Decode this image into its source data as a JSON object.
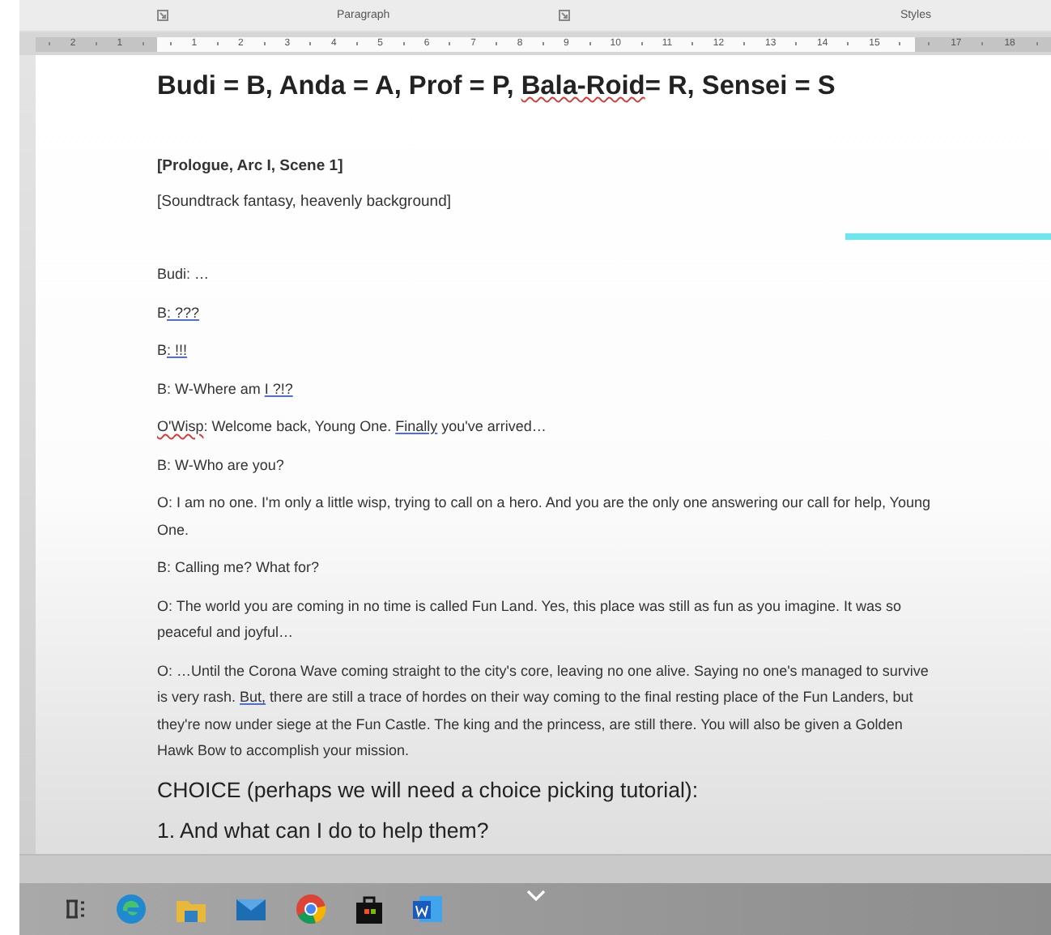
{
  "ribbon": {
    "groups": [
      "Paragraph",
      "Styles"
    ]
  },
  "ruler": {
    "left_numbers": [
      "2",
      "1"
    ],
    "numbers": [
      "1",
      "2",
      "3",
      "4",
      "5",
      "6",
      "7",
      "8",
      "9",
      "10",
      "11",
      "12",
      "13",
      "14",
      "15"
    ],
    "right_numbers": [
      "17",
      "18"
    ]
  },
  "document": {
    "paragraphs": [
      {
        "kind": "heading",
        "segments": [
          {
            "text": "Budi = B, Anda = A, Prof = P, ",
            "kind": "plain"
          },
          {
            "text": "Bala-Roid",
            "kind": "spelling"
          },
          {
            "text": "= R, Sensei = S",
            "kind": "plain"
          }
        ]
      },
      {
        "kind": "label",
        "segments": [
          {
            "text": "[Prologue, Arc I, Scene 1]",
            "kind": "plain"
          }
        ]
      },
      {
        "kind": "note",
        "segments": [
          {
            "text": "[Soundtrack fantasy, heavenly background]",
            "kind": "plain"
          }
        ]
      },
      {
        "kind": "line",
        "segments": [
          {
            "text": "Budi: …",
            "kind": "plain"
          }
        ]
      },
      {
        "kind": "line",
        "segments": [
          {
            "text": "B",
            "kind": "plain"
          },
          {
            "text": ": ???",
            "kind": "grammar"
          }
        ]
      },
      {
        "kind": "line",
        "segments": [
          {
            "text": "B",
            "kind": "plain"
          },
          {
            "text": ": !!!",
            "kind": "grammar"
          }
        ]
      },
      {
        "kind": "line",
        "segments": [
          {
            "text": "B: W-Where am ",
            "kind": "plain"
          },
          {
            "text": "I ?!?",
            "kind": "grammar"
          }
        ]
      },
      {
        "kind": "line",
        "segments": [
          {
            "text": "O'Wisp",
            "kind": "spelling"
          },
          {
            "text": ": Welcome back, Young One. ",
            "kind": "plain"
          },
          {
            "text": "Finally",
            "kind": "grammar"
          },
          {
            "text": " you've arrived…",
            "kind": "plain"
          }
        ]
      },
      {
        "kind": "line",
        "segments": [
          {
            "text": "B: W-Who are you?",
            "kind": "plain"
          }
        ]
      },
      {
        "kind": "line",
        "segments": [
          {
            "text": "O: I am no one. I'm only a little wisp, trying to call on a hero. And you are the only one answering our call for help, Young One.",
            "kind": "plain"
          }
        ]
      },
      {
        "kind": "line",
        "segments": [
          {
            "text": "B: Calling me? What for?",
            "kind": "plain"
          }
        ]
      },
      {
        "kind": "line",
        "segments": [
          {
            "text": "O: The world you are coming in no time is called Fun Land. Yes, this place was still as fun as you imagine. It was so peaceful and joyful…",
            "kind": "plain"
          }
        ]
      },
      {
        "kind": "line",
        "segments": [
          {
            "text": "O: …Until the Corona Wave coming straight to the city's core, leaving no one alive. Saying no one's managed to survive is very rash. ",
            "kind": "plain"
          },
          {
            "text": "But,",
            "kind": "grammar"
          },
          {
            "text": " there are still a trace of hordes on their way coming to the final resting place of the Fun Landers, but they're now under siege at the Fun Castle. The king and the princess, are still there. You will also be given a Golden Hawk Bow to accomplish your mission.",
            "kind": "plain"
          }
        ]
      },
      {
        "kind": "choice",
        "segments": [
          {
            "text": "CHOICE (perhaps we will need a choice picking tutorial):",
            "kind": "plain"
          }
        ]
      },
      {
        "kind": "choice",
        "segments": [
          {
            "text": "1. And what can I do to help them?",
            "kind": "plain"
          }
        ]
      }
    ]
  }
}
